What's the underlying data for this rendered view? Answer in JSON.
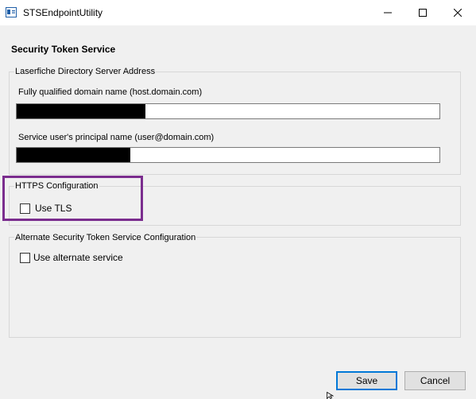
{
  "window": {
    "title": "STSEndpointUtility",
    "icon": "app-icon",
    "controls": {
      "minimize": "minimize-icon",
      "maximize": "maximize-icon",
      "close": "close-icon"
    }
  },
  "heading": "Security Token Service",
  "directory_server": {
    "legend": "Laserfiche Directory Server Address",
    "fqdn_label": "Fully qualified domain name (host.domain.com)",
    "fqdn_value": "",
    "upn_label": "Service user's principal name (user@domain.com)",
    "upn_value": ""
  },
  "https": {
    "legend": "HTTPS Configuration",
    "use_tls_label": "Use TLS",
    "use_tls_checked": false
  },
  "alternate": {
    "legend": "Alternate Security Token Service Configuration",
    "use_alternate_label": "Use alternate service",
    "use_alternate_checked": false
  },
  "buttons": {
    "save": "Save",
    "cancel": "Cancel"
  },
  "colors": {
    "highlight": "#7b2d8e",
    "default_button_border": "#0078d7",
    "window_bg": "#f0f0f0"
  }
}
